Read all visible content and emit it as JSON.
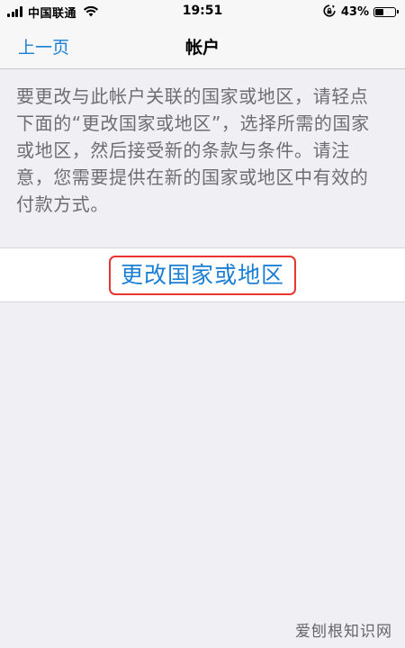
{
  "status_bar": {
    "carrier": "中国联通",
    "time": "19:51",
    "battery_percent": "43%",
    "battery_level": 0.43,
    "icons": [
      "signal-icon",
      "wifi-icon",
      "rotation-lock-icon",
      "battery-icon"
    ]
  },
  "nav": {
    "back_label": "上一页",
    "title": "帐户"
  },
  "description": "要更改与此帐户关联的国家或地区，请轻点下面的“更改国家或地区”，选择所需的国家或地区，然后接受新的条款与条件。请注意，您需要提供在新的国家或地区中有效的付款方式。",
  "action": {
    "label": "更改国家或地区"
  },
  "colors": {
    "link_blue": "#1a7fd4",
    "highlight_red": "#e8352e",
    "background": "#efeff4"
  },
  "watermark": "爱刨根知识网"
}
